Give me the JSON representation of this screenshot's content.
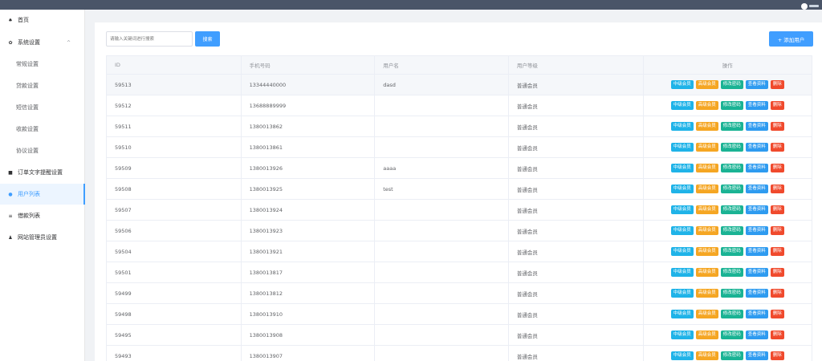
{
  "sidebar": {
    "items": [
      {
        "label": "首页",
        "icon": "home-icon",
        "glyph": "♠"
      },
      {
        "label": "系统设置",
        "icon": "gear-icon",
        "glyph": "✿",
        "chevron": "^"
      },
      {
        "label": "常规设置"
      },
      {
        "label": "贷款设置"
      },
      {
        "label": "短信设置"
      },
      {
        "label": "收款设置"
      },
      {
        "label": "协议设置"
      },
      {
        "label": "订单文字提醒设置",
        "icon": "grid-icon",
        "glyph": "■"
      },
      {
        "label": "用户列表",
        "icon": "user-icon",
        "glyph": "●"
      },
      {
        "label": "借款列表",
        "icon": "list-icon",
        "glyph": "≡"
      },
      {
        "label": "网站管理员设置",
        "icon": "person-icon",
        "glyph": "♟"
      }
    ]
  },
  "search": {
    "placeholder": "请输入关键词进行搜索",
    "button": "搜索"
  },
  "add_button": "+ 添加用户",
  "table": {
    "headers": {
      "id": "ID",
      "phone": "手机号码",
      "name": "用户名",
      "level": "用户等级",
      "ops": "操作"
    },
    "actions": {
      "mid": "中级会员",
      "high": "高级会员",
      "pwd": "修改密码",
      "view": "查看资料",
      "del": "删除"
    },
    "rows": [
      {
        "id": "59513",
        "phone": "13344440000",
        "name": "dasd",
        "level": "普通会员"
      },
      {
        "id": "59512",
        "phone": "13688889999",
        "name": "",
        "level": "普通会员"
      },
      {
        "id": "59511",
        "phone": "1380013862",
        "name": "",
        "level": "普通会员"
      },
      {
        "id": "59510",
        "phone": "1380013861",
        "name": "",
        "level": "普通会员"
      },
      {
        "id": "59509",
        "phone": "1380013926",
        "name": "aaaa",
        "level": "普通会员"
      },
      {
        "id": "59508",
        "phone": "1380013925",
        "name": "test",
        "level": "普通会员"
      },
      {
        "id": "59507",
        "phone": "1380013924",
        "name": "",
        "level": "普通会员"
      },
      {
        "id": "59506",
        "phone": "1380013923",
        "name": "",
        "level": "普通会员"
      },
      {
        "id": "59504",
        "phone": "1380013921",
        "name": "",
        "level": "普通会员"
      },
      {
        "id": "59501",
        "phone": "1380013817",
        "name": "",
        "level": "普通会员"
      },
      {
        "id": "59499",
        "phone": "1380013812",
        "name": "",
        "level": "普通会员"
      },
      {
        "id": "59498",
        "phone": "1380013910",
        "name": "",
        "level": "普通会员"
      },
      {
        "id": "59495",
        "phone": "1380013908",
        "name": "",
        "level": "普通会员"
      },
      {
        "id": "59493",
        "phone": "1380013907",
        "name": "",
        "level": "普通会员"
      }
    ]
  }
}
